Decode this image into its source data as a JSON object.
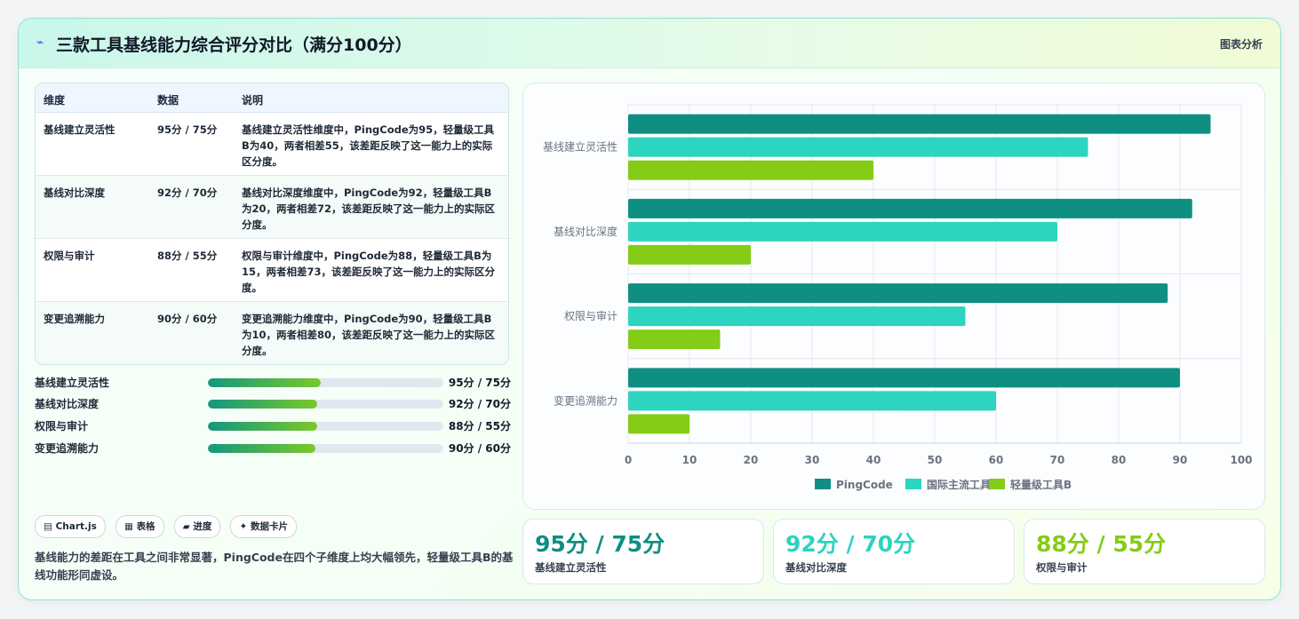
{
  "header": {
    "icon": "lightning-icon",
    "title": "三款工具基线能力综合评分对比（满分100分）",
    "tag": "图表分析"
  },
  "table": {
    "headers": [
      "维度",
      "数据",
      "说明"
    ],
    "rows": [
      {
        "dim": "基线建立灵活性",
        "data": "95分 / 75分",
        "desc": "基线建立灵活性维度中，PingCode为95，轻量级工具B为40，两者相差55，该差距反映了这一能力上的实际区分度。"
      },
      {
        "dim": "基线对比深度",
        "data": "92分 / 70分",
        "desc": "基线对比深度维度中，PingCode为92，轻量级工具B为20，两者相差72，该差距反映了这一能力上的实际区分度。"
      },
      {
        "dim": "权限与审计",
        "data": "88分 / 55分",
        "desc": "权限与审计维度中，PingCode为88，轻量级工具B为15，两者相差73，该差距反映了这一能力上的实际区分度。"
      },
      {
        "dim": "变更追溯能力",
        "data": "90分 / 60分",
        "desc": "变更追溯能力维度中，PingCode为90，轻量级工具B为10，两者相差80，该差距反映了这一能力上的实际区分度。"
      }
    ]
  },
  "progress": [
    {
      "label": "基线建立灵活性",
      "value": "95分 / 75分",
      "fraction": 0.48
    },
    {
      "label": "基线对比深度",
      "value": "92分 / 70分",
      "fraction": 0.465
    },
    {
      "label": "权限与审计",
      "value": "88分 / 55分",
      "fraction": 0.465
    },
    {
      "label": "变更追溯能力",
      "value": "90分 / 60分",
      "fraction": 0.455
    }
  ],
  "chips": [
    {
      "icon": "chart-icon",
      "label": "Chart.js"
    },
    {
      "icon": "table-icon",
      "label": "表格"
    },
    {
      "icon": "progress-icon",
      "label": "进度"
    },
    {
      "icon": "sparkle-icon",
      "label": "数据卡片"
    }
  ],
  "note": "基线能力的差距在工具之间非常显著，PingCode在四个子维度上均大幅领先，轻量级工具B的基线功能形同虚设。",
  "stats": [
    {
      "big": "95分 / 75分",
      "sub": "基线建立灵活性",
      "color": "#0e8f82"
    },
    {
      "big": "92分 / 70分",
      "sub": "基线对比深度",
      "color": "#2dd4bf"
    },
    {
      "big": "88分 / 55分",
      "sub": "权限与审计",
      "color": "#84cc16"
    }
  ],
  "chart_data": {
    "type": "bar",
    "orientation": "horizontal",
    "categories": [
      "基线建立灵活性",
      "基线对比深度",
      "权限与审计",
      "变更追溯能力"
    ],
    "series": [
      {
        "name": "PingCode",
        "values": [
          95,
          92,
          88,
          90
        ],
        "color": "#0e8f82"
      },
      {
        "name": "国际主流工具A",
        "values": [
          75,
          70,
          55,
          60
        ],
        "color": "#2dd4bf"
      },
      {
        "name": "轻量级工具B",
        "values": [
          40,
          20,
          15,
          10
        ],
        "color": "#84cc16"
      }
    ],
    "xlim": [
      0,
      100
    ],
    "xticks": [
      0,
      10,
      20,
      30,
      40,
      50,
      60,
      70,
      80,
      90,
      100
    ],
    "grid": true,
    "legend": "bottom"
  }
}
